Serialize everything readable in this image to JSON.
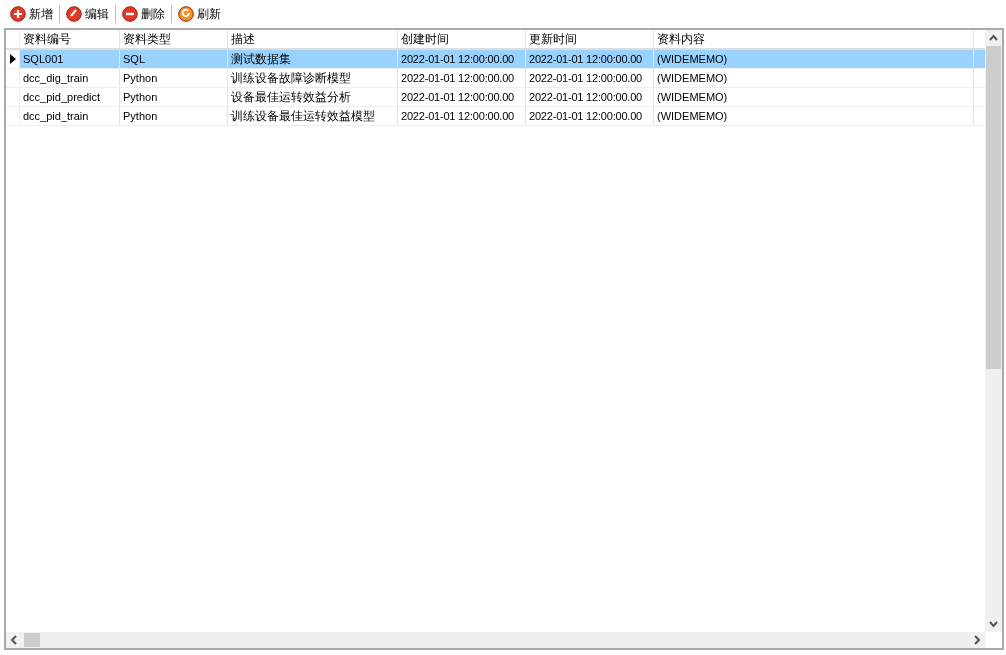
{
  "toolbar": [
    {
      "kind": "add",
      "label": "新增"
    },
    {
      "kind": "edit",
      "label": "编辑"
    },
    {
      "kind": "delete",
      "label": "删除"
    },
    {
      "kind": "refresh",
      "label": "刷新"
    }
  ],
  "table": {
    "columns": [
      "资料编号",
      "资料类型",
      "描述",
      "创建时间",
      "更新时间",
      "资料内容"
    ],
    "rows": [
      {
        "selected": true,
        "cells": [
          "SQL001",
          "SQL",
          "测试数据集",
          "2022-01-01 12:00:00.00",
          "2022-01-01 12:00:00.00",
          "(WIDEMEMO)"
        ]
      },
      {
        "selected": false,
        "cells": [
          "dcc_dig_train",
          "Python",
          "训练设备故障诊断模型",
          "2022-01-01 12:00:00.00",
          "2022-01-01 12:00:00.00",
          "(WIDEMEMO)"
        ]
      },
      {
        "selected": false,
        "cells": [
          "dcc_pid_predict",
          "Python",
          "设备最佳运转效益分析",
          "2022-01-01 12:00:00.00",
          "2022-01-01 12:00:00.00",
          "(WIDEMEMO)"
        ]
      },
      {
        "selected": false,
        "cells": [
          "dcc_pid_train",
          "Python",
          "训练设备最佳运转效益模型",
          "2022-01-01 12:00:00.00",
          "2022-01-01 12:00:00.00",
          "(WIDEMEMO)"
        ]
      }
    ]
  }
}
